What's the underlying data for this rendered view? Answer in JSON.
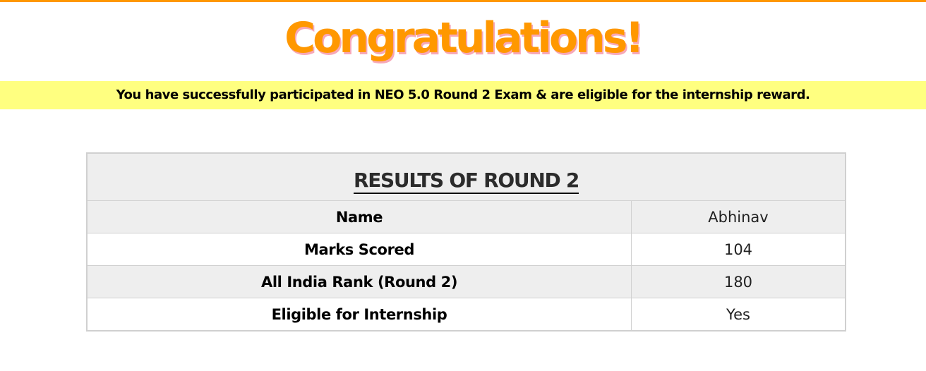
{
  "header": {
    "title": "Congratulations!"
  },
  "banner": {
    "message": "You have successfully participated in NEO 5.0 Round 2 Exam & are eligible for the internship reward."
  },
  "results": {
    "title": "RESULTS OF ROUND 2",
    "rows": [
      {
        "label": "Name",
        "value": "Abhinav"
      },
      {
        "label": "Marks Scored",
        "value": "104"
      },
      {
        "label": "All India Rank (Round 2)",
        "value": "180"
      },
      {
        "label": "Eligible for Internship",
        "value": "Yes"
      }
    ]
  },
  "colors": {
    "accent": "#ff9800",
    "title_shadow": "#f7a8b8",
    "banner_bg": "#ffff80",
    "table_shade": "#eeeeee",
    "table_border": "#d0d0d0"
  }
}
